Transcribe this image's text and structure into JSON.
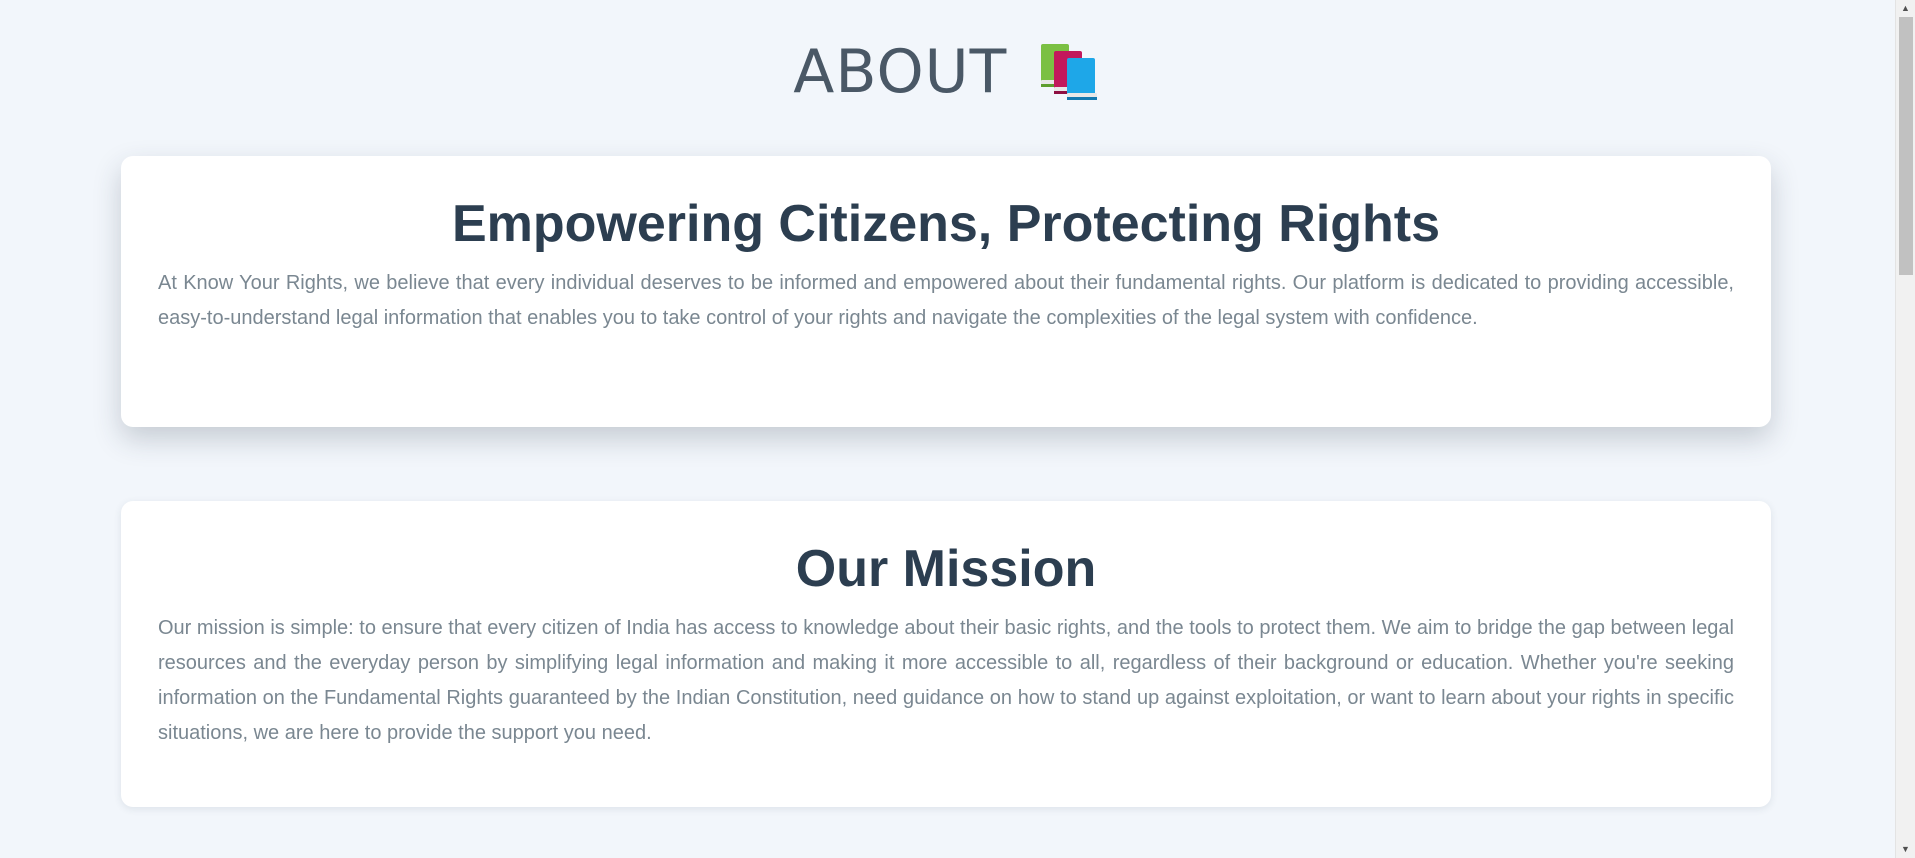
{
  "header": {
    "title": "ABOUT",
    "icon": "books-icon"
  },
  "sections": [
    {
      "heading": "Empowering Citizens, Protecting Rights",
      "body": "At Know Your Rights, we believe that every individual deserves to be informed and empowered about their fundamental rights. Our platform is dedicated to providing accessible, easy-to-understand legal information that enables you to take control of your rights and navigate the complexities of the legal system with confidence."
    },
    {
      "heading": "Our Mission",
      "body": "Our mission is simple: to ensure that every citizen of India has access to knowledge about their basic rights, and the tools to protect them. We aim to bridge the gap between legal resources and the everyday person by simplifying legal information and making it more accessible to all, regardless of their background or education. Whether you're seeking information on the Fundamental Rights guaranteed by the Indian Constitution, need guidance on how to stand up against exploitation, or want to learn about your rights in specific situations, we are here to provide the support you need."
    }
  ],
  "colors": {
    "background": "#f2f6fb",
    "card": "#ffffff",
    "heading": "#2c3e50",
    "body_text": "#7a8791",
    "title": "#4a5866"
  }
}
